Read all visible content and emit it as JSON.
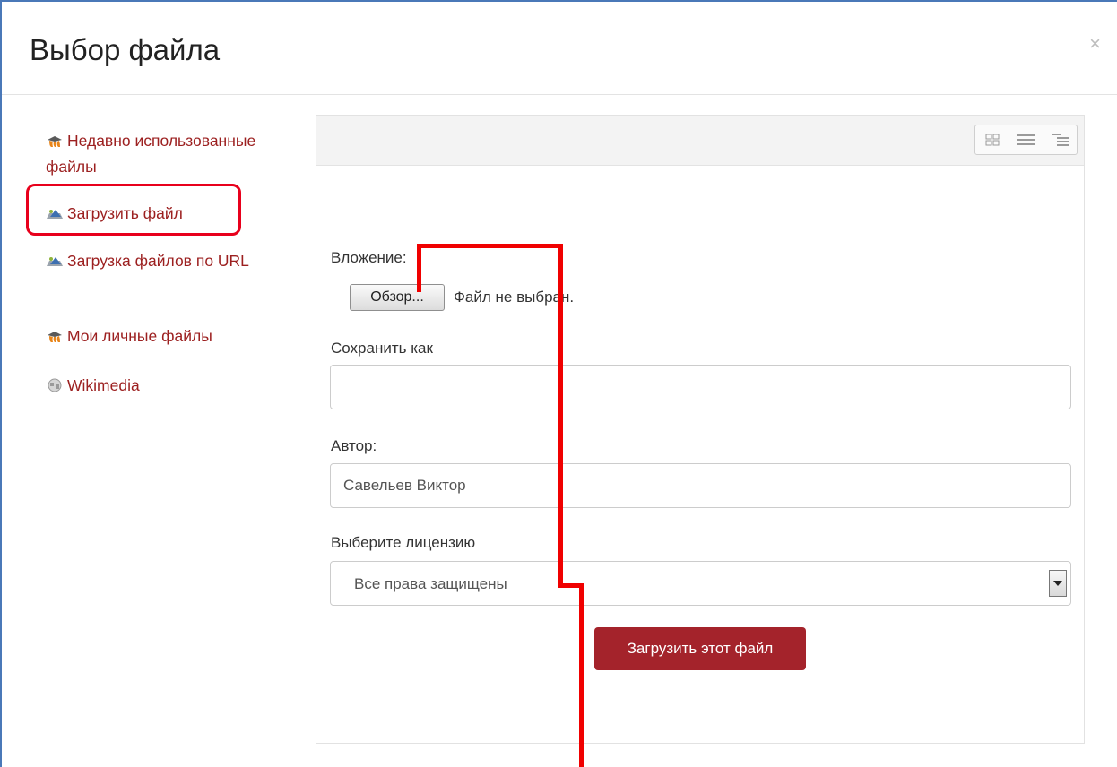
{
  "dialog": {
    "title": "Выбор файла",
    "close_glyph": "×"
  },
  "sidebar": {
    "items": [
      {
        "label": "Недавно использованные файлы",
        "icon": "moodle-icon"
      },
      {
        "label": "Загрузить файл",
        "icon": "upload-icon"
      },
      {
        "label": "Загрузка файлов по URL",
        "icon": "upload-icon"
      },
      {
        "label": "Мои личные файлы",
        "icon": "moodle-icon"
      },
      {
        "label": "Wikimedia",
        "icon": "wikimedia-icon"
      }
    ]
  },
  "toolbar": {
    "views": [
      "icons-view",
      "list-view",
      "tree-view"
    ]
  },
  "form": {
    "attachment_label": "Вложение:",
    "browse_label": "Обзор...",
    "no_file_text": "Файл не выбран.",
    "save_as_label": "Сохранить как",
    "save_as_value": "",
    "author_label": "Автор:",
    "author_value": "Савельев Виктор",
    "license_label": "Выберите лицензию",
    "license_value": "Все права защищены",
    "submit_label": "Загрузить этот файл"
  },
  "colors": {
    "link": "#9c2020",
    "accent": "#a4232b",
    "annotation": "#f00000",
    "frame": "#4a78b8"
  }
}
